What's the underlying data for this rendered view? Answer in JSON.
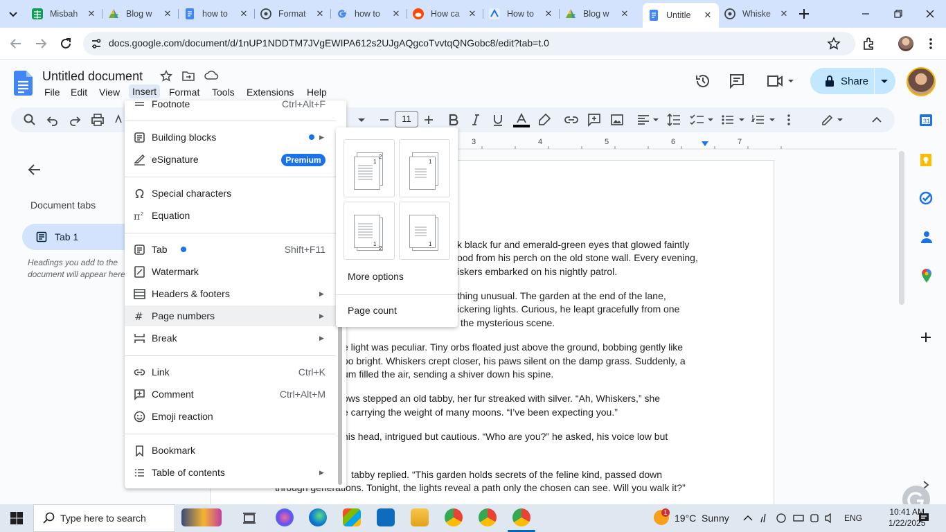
{
  "browser": {
    "tabs": [
      {
        "title": "Misbah",
        "color": "#0f9d58",
        "close": "✕"
      },
      {
        "title": "Blog w",
        "color": "#fbbc04",
        "close": "✕"
      },
      {
        "title": "how to",
        "color": "#4285f4",
        "close": "✕"
      },
      {
        "title": "Format",
        "color": "#5f6368",
        "close": "✕"
      },
      {
        "title": "how to",
        "color": "#4285f4",
        "close": "✕"
      },
      {
        "title": "How ca",
        "color": "#ff4500",
        "close": "✕"
      },
      {
        "title": "How to",
        "color": "#1a73e8",
        "close": "✕"
      },
      {
        "title": "Blog w",
        "color": "#fbbc04",
        "close": "✕"
      },
      {
        "title": "Untitle",
        "color": "#4285f4",
        "close": "✕"
      },
      {
        "title": "Whiske",
        "color": "#5f6368",
        "close": "✕"
      }
    ],
    "url": "docs.google.com/document/d/1nUP1NDDTM7JVgEWIPA612s2UJgAQgcoTvvtqQNGobc8/edit?tab=t.0"
  },
  "docs": {
    "title": "Untitled document",
    "menu": [
      "File",
      "Edit",
      "View",
      "Insert",
      "Format",
      "Tools",
      "Extensions",
      "Help"
    ],
    "share_label": "Share",
    "font_size": "11"
  },
  "sidebar": {
    "heading": "Document tabs",
    "tab_label": "Tab 1",
    "hint": "Headings you add to the document will appear here."
  },
  "ruler": {
    "numbers": [
      "3",
      "4",
      "5",
      "6",
      "7"
    ]
  },
  "insert_menu": {
    "items": [
      {
        "label": "Footnote",
        "shortcut": "Ctrl+Alt+F"
      },
      {
        "label": "Building blocks",
        "shortcut": ""
      },
      {
        "label": "eSignature",
        "shortcut": "",
        "badge": "Premium"
      },
      {
        "label": "Special characters",
        "shortcut": ""
      },
      {
        "label": "Equation",
        "shortcut": ""
      },
      {
        "label": "Tab",
        "shortcut": "Shift+F11"
      },
      {
        "label": "Watermark",
        "shortcut": ""
      },
      {
        "label": "Headers & footers",
        "shortcut": ""
      },
      {
        "label": "Page numbers",
        "shortcut": ""
      },
      {
        "label": "Break",
        "shortcut": ""
      },
      {
        "label": "Link",
        "shortcut": "Ctrl+K"
      },
      {
        "label": "Comment",
        "shortcut": "Ctrl+Alt+M"
      },
      {
        "label": "Emoji reaction",
        "shortcut": ""
      },
      {
        "label": "Bookmark",
        "shortcut": ""
      },
      {
        "label": "Table of contents",
        "shortcut": ""
      }
    ]
  },
  "page_numbers_menu": {
    "options": [
      {
        "marks": [
          "1",
          "2"
        ]
      },
      {
        "marks": [
          "1"
        ]
      },
      {
        "marks": [
          "1",
          "2"
        ]
      },
      {
        "marks": [
          "1"
        ]
      }
    ],
    "more_options": "More options",
    "page_count": "Page count"
  },
  "document": {
    "lines": [
      "k black fur and emerald-green eyes that glowed faintly",
      "ood from his perch on the old stone wall. Every evening,",
      "iskers embarked on his nightly patrol.",
      "thing unusual. The garden at the end of the lane,",
      "ickering lights. Curious, he leapt gracefully from one",
      "the mysterious scene.",
      "e light was peculiar. Tiny orbs floated just above the ground, bobbing gently like",
      "oo bright. Whiskers crept closer, his paws silent on the damp grass. Suddenly, a",
      "um filled the air, sending a shiver down his spine.",
      "ows stepped an old tabby, her fur streaked with silver. “Ah, Whiskers,” she",
      "e carrying the weight of many moons. “I’ve been expecting you.”",
      "his head, intrigued but cautious. “Who are you?” he asked, his voice low but",
      "tabby replied. “This garden holds secrets of the feline kind, passed down",
      "through generations. Tonight, the lights reveal a path only the chosen can see. Will you walk it?”"
    ]
  },
  "taskbar": {
    "search_placeholder": "Type here to search",
    "weather": "19°C  Sunny",
    "weather_badge": "1",
    "lang": "ENG",
    "time": "10:41 AM",
    "date": "1/22/2025"
  }
}
